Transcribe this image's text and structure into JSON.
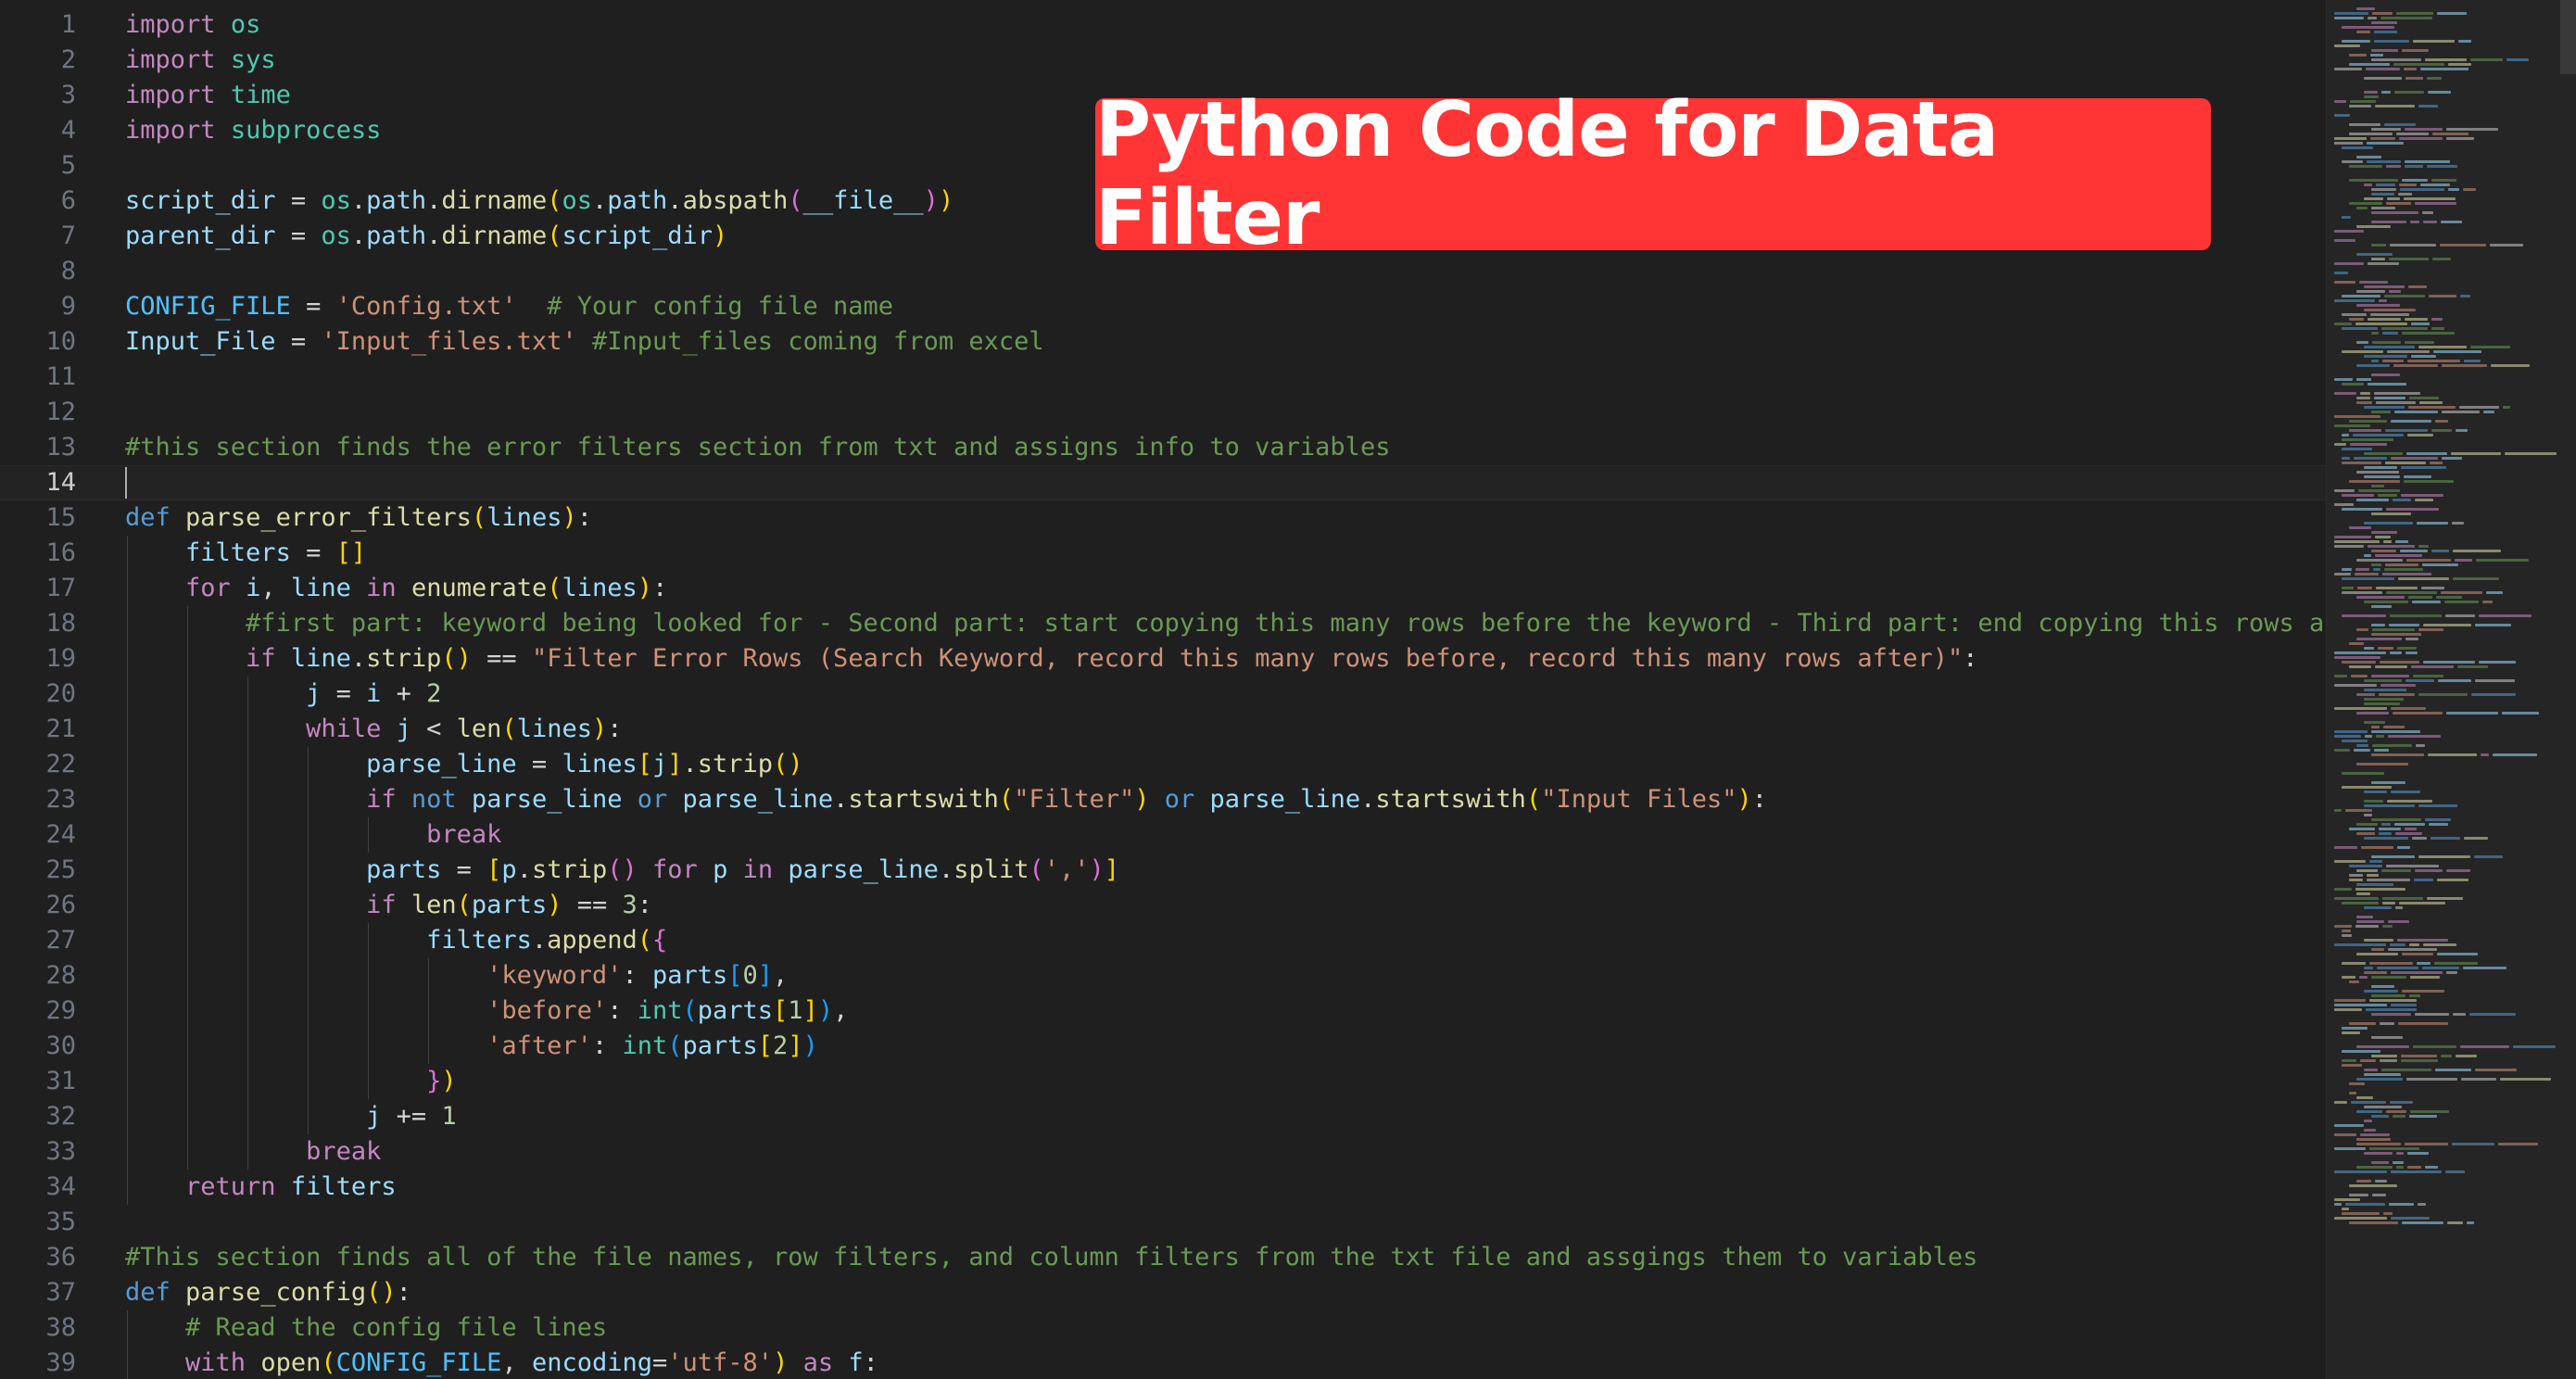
{
  "editor": {
    "active_line": 14,
    "lines": [
      [
        [
          "t-ctrl",
          "import"
        ],
        [
          "t-op",
          " "
        ],
        [
          "t-cls",
          "os"
        ]
      ],
      [
        [
          "t-ctrl",
          "import"
        ],
        [
          "t-op",
          " "
        ],
        [
          "t-cls",
          "sys"
        ]
      ],
      [
        [
          "t-ctrl",
          "import"
        ],
        [
          "t-op",
          " "
        ],
        [
          "t-cls",
          "time"
        ]
      ],
      [
        [
          "t-ctrl",
          "import"
        ],
        [
          "t-op",
          " "
        ],
        [
          "t-cls",
          "subprocess"
        ]
      ],
      [],
      [
        [
          "t-var",
          "script_dir"
        ],
        [
          "t-op",
          " = "
        ],
        [
          "t-cls",
          "os"
        ],
        [
          "t-op",
          "."
        ],
        [
          "t-var",
          "path"
        ],
        [
          "t-op",
          "."
        ],
        [
          "t-fn",
          "dirname"
        ],
        [
          "t-b1",
          "("
        ],
        [
          "t-cls",
          "os"
        ],
        [
          "t-op",
          "."
        ],
        [
          "t-var",
          "path"
        ],
        [
          "t-op",
          "."
        ],
        [
          "t-fn",
          "abspath"
        ],
        [
          "t-b2",
          "("
        ],
        [
          "t-var",
          "__file__"
        ],
        [
          "t-b2",
          ")"
        ],
        [
          "t-b1",
          ")"
        ]
      ],
      [
        [
          "t-var",
          "parent_dir"
        ],
        [
          "t-op",
          " = "
        ],
        [
          "t-cls",
          "os"
        ],
        [
          "t-op",
          "."
        ],
        [
          "t-var",
          "path"
        ],
        [
          "t-op",
          "."
        ],
        [
          "t-fn",
          "dirname"
        ],
        [
          "t-b1",
          "("
        ],
        [
          "t-var",
          "script_dir"
        ],
        [
          "t-b1",
          ")"
        ]
      ],
      [],
      [
        [
          "t-const",
          "CONFIG_FILE"
        ],
        [
          "t-op",
          " = "
        ],
        [
          "t-str",
          "'Config.txt'"
        ],
        [
          "t-op",
          "  "
        ],
        [
          "t-cmt",
          "# Your config file name"
        ]
      ],
      [
        [
          "t-var",
          "Input_File"
        ],
        [
          "t-op",
          " = "
        ],
        [
          "t-str",
          "'Input_files.txt'"
        ],
        [
          "t-op",
          " "
        ],
        [
          "t-cmt",
          "#Input_files coming from excel"
        ]
      ],
      [],
      [],
      [
        [
          "t-cmt",
          "#this section finds the error filters section from txt and assigns info to variables"
        ]
      ],
      [],
      [
        [
          "t-kw",
          "def"
        ],
        [
          "t-op",
          " "
        ],
        [
          "t-fn",
          "parse_error_filters"
        ],
        [
          "t-b1",
          "("
        ],
        [
          "t-var",
          "lines"
        ],
        [
          "t-b1",
          ")"
        ],
        [
          "t-op",
          ":"
        ]
      ],
      [
        [
          "t-op",
          "    "
        ],
        [
          "t-var",
          "filters"
        ],
        [
          "t-op",
          " = "
        ],
        [
          "t-b1",
          "[]"
        ]
      ],
      [
        [
          "t-op",
          "    "
        ],
        [
          "t-ctrl",
          "for"
        ],
        [
          "t-op",
          " "
        ],
        [
          "t-var",
          "i"
        ],
        [
          "t-op",
          ", "
        ],
        [
          "t-var",
          "line"
        ],
        [
          "t-op",
          " "
        ],
        [
          "t-ctrl",
          "in"
        ],
        [
          "t-op",
          " "
        ],
        [
          "t-fn",
          "enumerate"
        ],
        [
          "t-b1",
          "("
        ],
        [
          "t-var",
          "lines"
        ],
        [
          "t-b1",
          ")"
        ],
        [
          "t-op",
          ":"
        ]
      ],
      [
        [
          "t-op",
          "        "
        ],
        [
          "t-cmt",
          "#first part: keyword being looked for - Second part: start copying this many rows before the keyword - Third part: end copying this rows after the keyword"
        ]
      ],
      [
        [
          "t-op",
          "        "
        ],
        [
          "t-ctrl",
          "if"
        ],
        [
          "t-op",
          " "
        ],
        [
          "t-var",
          "line"
        ],
        [
          "t-op",
          "."
        ],
        [
          "t-fn",
          "strip"
        ],
        [
          "t-b1",
          "()"
        ],
        [
          "t-op",
          " == "
        ],
        [
          "t-str",
          "\"Filter Error Rows (Search Keyword, record this many rows before, record this many rows after)\""
        ],
        [
          "t-op",
          ":"
        ]
      ],
      [
        [
          "t-op",
          "            "
        ],
        [
          "t-var",
          "j"
        ],
        [
          "t-op",
          " = "
        ],
        [
          "t-var",
          "i"
        ],
        [
          "t-op",
          " + "
        ],
        [
          "t-num",
          "2"
        ]
      ],
      [
        [
          "t-op",
          "            "
        ],
        [
          "t-ctrl",
          "while"
        ],
        [
          "t-op",
          " "
        ],
        [
          "t-var",
          "j"
        ],
        [
          "t-op",
          " < "
        ],
        [
          "t-fn",
          "len"
        ],
        [
          "t-b1",
          "("
        ],
        [
          "t-var",
          "lines"
        ],
        [
          "t-b1",
          ")"
        ],
        [
          "t-op",
          ":"
        ]
      ],
      [
        [
          "t-op",
          "                "
        ],
        [
          "t-var",
          "parse_line"
        ],
        [
          "t-op",
          " = "
        ],
        [
          "t-var",
          "lines"
        ],
        [
          "t-b1",
          "["
        ],
        [
          "t-var",
          "j"
        ],
        [
          "t-b1",
          "]"
        ],
        [
          "t-op",
          "."
        ],
        [
          "t-fn",
          "strip"
        ],
        [
          "t-b1",
          "()"
        ]
      ],
      [
        [
          "t-op",
          "                "
        ],
        [
          "t-ctrl",
          "if"
        ],
        [
          "t-op",
          " "
        ],
        [
          "t-kw",
          "not"
        ],
        [
          "t-op",
          " "
        ],
        [
          "t-var",
          "parse_line"
        ],
        [
          "t-op",
          " "
        ],
        [
          "t-kw",
          "or"
        ],
        [
          "t-op",
          " "
        ],
        [
          "t-var",
          "parse_line"
        ],
        [
          "t-op",
          "."
        ],
        [
          "t-fn",
          "startswith"
        ],
        [
          "t-b1",
          "("
        ],
        [
          "t-str",
          "\"Filter\""
        ],
        [
          "t-b1",
          ")"
        ],
        [
          "t-op",
          " "
        ],
        [
          "t-kw",
          "or"
        ],
        [
          "t-op",
          " "
        ],
        [
          "t-var",
          "parse_line"
        ],
        [
          "t-op",
          "."
        ],
        [
          "t-fn",
          "startswith"
        ],
        [
          "t-b1",
          "("
        ],
        [
          "t-str",
          "\"Input Files\""
        ],
        [
          "t-b1",
          ")"
        ],
        [
          "t-op",
          ":"
        ]
      ],
      [
        [
          "t-op",
          "                    "
        ],
        [
          "t-ctrl",
          "break"
        ]
      ],
      [
        [
          "t-op",
          "                "
        ],
        [
          "t-var",
          "parts"
        ],
        [
          "t-op",
          " = "
        ],
        [
          "t-b1",
          "["
        ],
        [
          "t-var",
          "p"
        ],
        [
          "t-op",
          "."
        ],
        [
          "t-fn",
          "strip"
        ],
        [
          "t-b2",
          "()"
        ],
        [
          "t-op",
          " "
        ],
        [
          "t-ctrl",
          "for"
        ],
        [
          "t-op",
          " "
        ],
        [
          "t-var",
          "p"
        ],
        [
          "t-op",
          " "
        ],
        [
          "t-ctrl",
          "in"
        ],
        [
          "t-op",
          " "
        ],
        [
          "t-var",
          "parse_line"
        ],
        [
          "t-op",
          "."
        ],
        [
          "t-fn",
          "split"
        ],
        [
          "t-b2",
          "("
        ],
        [
          "t-str",
          "','"
        ],
        [
          "t-b2",
          ")"
        ],
        [
          "t-b1",
          "]"
        ]
      ],
      [
        [
          "t-op",
          "                "
        ],
        [
          "t-ctrl",
          "if"
        ],
        [
          "t-op",
          " "
        ],
        [
          "t-fn",
          "len"
        ],
        [
          "t-b1",
          "("
        ],
        [
          "t-var",
          "parts"
        ],
        [
          "t-b1",
          ")"
        ],
        [
          "t-op",
          " == "
        ],
        [
          "t-num",
          "3"
        ],
        [
          "t-op",
          ":"
        ]
      ],
      [
        [
          "t-op",
          "                    "
        ],
        [
          "t-var",
          "filters"
        ],
        [
          "t-op",
          "."
        ],
        [
          "t-fn",
          "append"
        ],
        [
          "t-b1",
          "("
        ],
        [
          "t-b2",
          "{"
        ]
      ],
      [
        [
          "t-op",
          "                        "
        ],
        [
          "t-str",
          "'keyword'"
        ],
        [
          "t-op",
          ": "
        ],
        [
          "t-var",
          "parts"
        ],
        [
          "t-b3",
          "["
        ],
        [
          "t-num",
          "0"
        ],
        [
          "t-b3",
          "]"
        ],
        [
          "t-op",
          ","
        ]
      ],
      [
        [
          "t-op",
          "                        "
        ],
        [
          "t-str",
          "'before'"
        ],
        [
          "t-op",
          ": "
        ],
        [
          "t-cls",
          "int"
        ],
        [
          "t-b3",
          "("
        ],
        [
          "t-var",
          "parts"
        ],
        [
          "t-b1",
          "["
        ],
        [
          "t-num",
          "1"
        ],
        [
          "t-b1",
          "]"
        ],
        [
          "t-b3",
          ")"
        ],
        [
          "t-op",
          ","
        ]
      ],
      [
        [
          "t-op",
          "                        "
        ],
        [
          "t-str",
          "'after'"
        ],
        [
          "t-op",
          ": "
        ],
        [
          "t-cls",
          "int"
        ],
        [
          "t-b3",
          "("
        ],
        [
          "t-var",
          "parts"
        ],
        [
          "t-b1",
          "["
        ],
        [
          "t-num",
          "2"
        ],
        [
          "t-b1",
          "]"
        ],
        [
          "t-b3",
          ")"
        ]
      ],
      [
        [
          "t-op",
          "                    "
        ],
        [
          "t-b2",
          "}"
        ],
        [
          "t-b1",
          ")"
        ]
      ],
      [
        [
          "t-op",
          "                "
        ],
        [
          "t-var",
          "j"
        ],
        [
          "t-op",
          " += "
        ],
        [
          "t-num",
          "1"
        ]
      ],
      [
        [
          "t-op",
          "            "
        ],
        [
          "t-ctrl",
          "break"
        ]
      ],
      [
        [
          "t-op",
          "    "
        ],
        [
          "t-ctrl",
          "return"
        ],
        [
          "t-op",
          " "
        ],
        [
          "t-var",
          "filters"
        ]
      ],
      [],
      [
        [
          "t-cmt",
          "#This section finds all of the file names, row filters, and column filters from the txt file and assgings them to variables"
        ]
      ],
      [
        [
          "t-kw",
          "def"
        ],
        [
          "t-op",
          " "
        ],
        [
          "t-fn",
          "parse_config"
        ],
        [
          "t-b1",
          "()"
        ],
        [
          "t-op",
          ":"
        ]
      ],
      [
        [
          "t-op",
          "    "
        ],
        [
          "t-cmt",
          "# Read the config file lines"
        ]
      ],
      [
        [
          "t-op",
          "    "
        ],
        [
          "t-ctrl",
          "with"
        ],
        [
          "t-op",
          " "
        ],
        [
          "t-fn",
          "open"
        ],
        [
          "t-b1",
          "("
        ],
        [
          "t-const",
          "CONFIG_FILE"
        ],
        [
          "t-op",
          ", "
        ],
        [
          "t-var",
          "encoding"
        ],
        [
          "t-op",
          "="
        ],
        [
          "t-str",
          "'utf-8'"
        ],
        [
          "t-b1",
          ")"
        ],
        [
          "t-op",
          " "
        ],
        [
          "t-ctrl",
          "as"
        ],
        [
          "t-op",
          " "
        ],
        [
          "t-var",
          "f"
        ],
        [
          "t-op",
          ":"
        ]
      ]
    ]
  },
  "banner": {
    "text": "Python Code for Data Filter"
  },
  "colors": {
    "background": "#1f1f1f",
    "banner": "#ff3535",
    "comment": "#6a9955",
    "string": "#ce9178",
    "keyword": "#569cd6",
    "control": "#c586c0",
    "function": "#dcdcaa",
    "variable": "#9cdcfe"
  }
}
